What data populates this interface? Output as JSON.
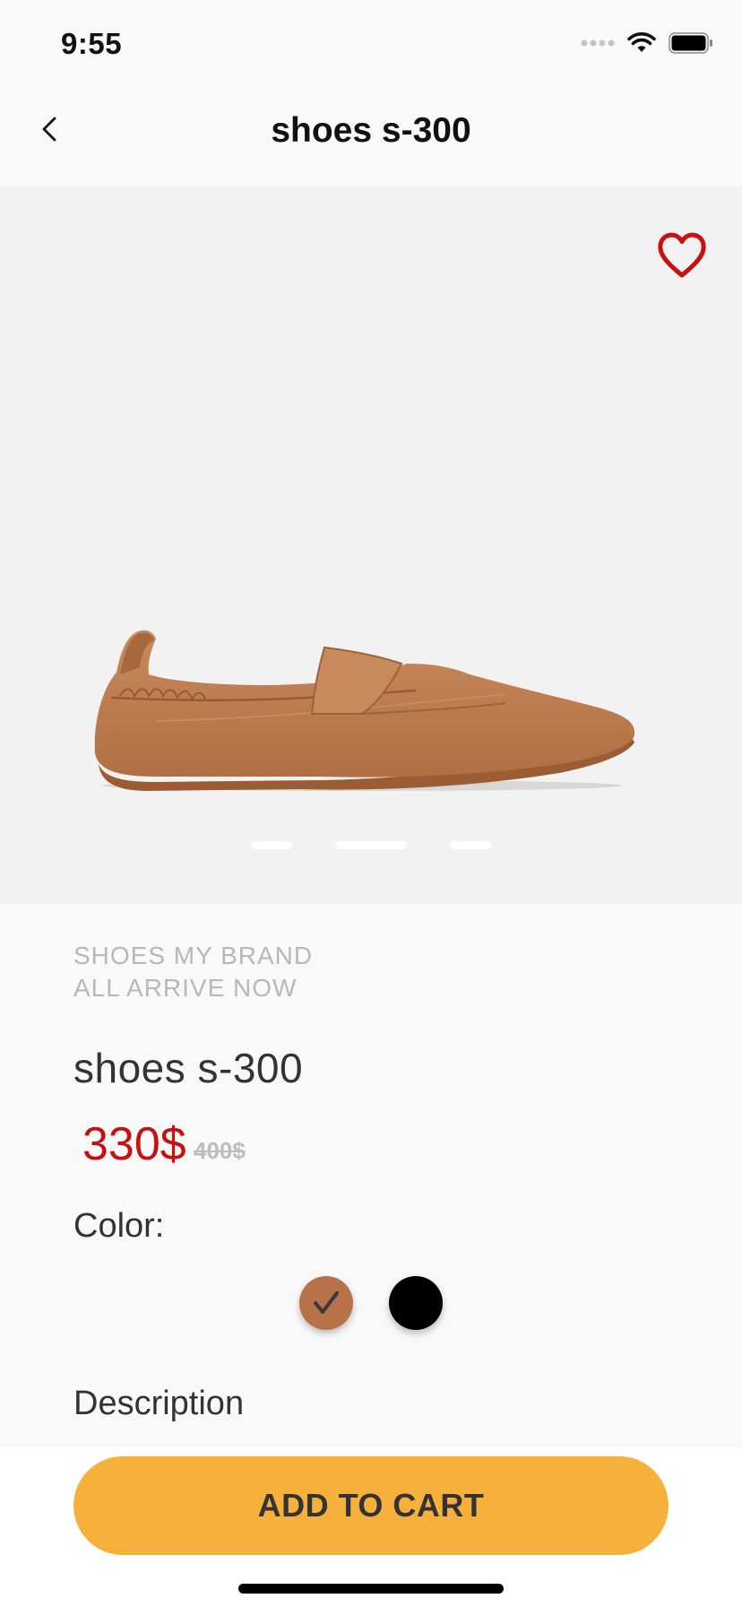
{
  "status_bar": {
    "time": "9:55",
    "icons": [
      "signal-dots-icon",
      "wifi-icon",
      "battery-icon"
    ]
  },
  "nav": {
    "back_icon": "chevron-left-icon",
    "title": "shoes s-300"
  },
  "hero": {
    "favorite_icon": "heart-outline-icon",
    "image": "tan-leather-loafer",
    "pager": {
      "count": 3,
      "active_index": 1
    }
  },
  "product": {
    "brand_line_1": "SHOES MY BRAND",
    "brand_line_2": "ALL ARRIVE NOW",
    "name": "shoes s-300",
    "price": "330$",
    "old_price": "400$",
    "color_label": "Color:",
    "colors": [
      {
        "hex": "#b8724a",
        "selected": true
      },
      {
        "hex": "#000000",
        "selected": false
      }
    ],
    "description_heading": "Description"
  },
  "actions": {
    "add_to_cart_label": "ADD TO CART"
  },
  "colors": {
    "accent": "#f6b13c",
    "price": "#c81010",
    "favorite": "#c81010"
  }
}
